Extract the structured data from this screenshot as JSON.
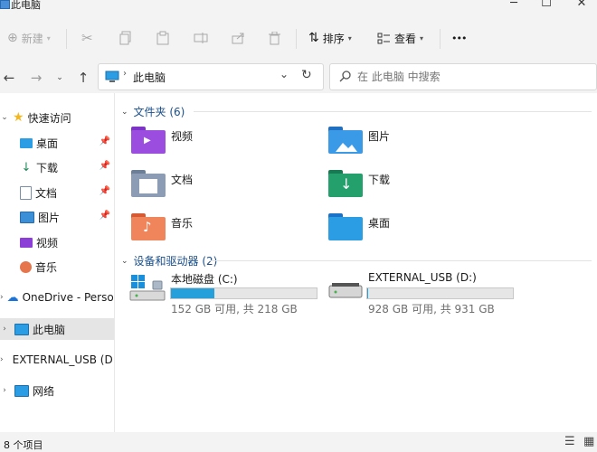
{
  "window": {
    "title": "此电脑"
  },
  "toolbar": {
    "new_label": "新建",
    "sort_label": "排序",
    "view_label": "查看",
    "more_label": "•••"
  },
  "address": {
    "location": "此电脑",
    "search_placeholder": "在 此电脑 中搜索"
  },
  "sidebar": {
    "quick_access": "快速访问",
    "items": [
      {
        "label": "桌面"
      },
      {
        "label": "下载"
      },
      {
        "label": "文档"
      },
      {
        "label": "图片"
      },
      {
        "label": "视频"
      },
      {
        "label": "音乐"
      }
    ],
    "onedrive": "OneDrive - Persona",
    "this_pc": "此电脑",
    "external_usb": "EXTERNAL_USB (D:",
    "network": "网络"
  },
  "main": {
    "folders_header": "文件夹 (6)",
    "folders": [
      {
        "name": "视频"
      },
      {
        "name": "图片"
      },
      {
        "name": "文档"
      },
      {
        "name": "下载"
      },
      {
        "name": "音乐"
      },
      {
        "name": "桌面"
      }
    ],
    "drives_header": "设备和驱动器 (2)",
    "drives": [
      {
        "name": "本地磁盘 (C:)",
        "usage": "152 GB 可用, 共 218 GB",
        "used_fraction": 0.3
      },
      {
        "name": "EXTERNAL_USB (D:)",
        "usage": "928 GB 可用, 共 931 GB",
        "used_fraction": 0.003
      }
    ]
  },
  "status": {
    "item_count": "8 个项目"
  },
  "colors": {
    "accent": "#26a0da",
    "folder_yellow": "#f6c84b",
    "selection": "#e5e5e5"
  }
}
